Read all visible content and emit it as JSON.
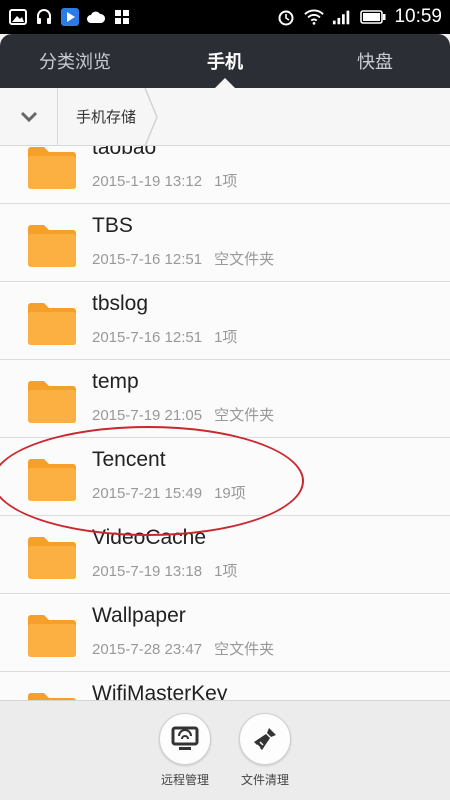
{
  "status_bar": {
    "time": "10:59"
  },
  "tabs": [
    {
      "label": "分类浏览",
      "active": false
    },
    {
      "label": "手机",
      "active": true
    },
    {
      "label": "快盘",
      "active": false
    }
  ],
  "breadcrumb": {
    "current": "手机存储"
  },
  "files": [
    {
      "name": "taobao",
      "date": "2015-1-19 13:12",
      "info": "1项"
    },
    {
      "name": "TBS",
      "date": "2015-7-16 12:51",
      "info": "空文件夹"
    },
    {
      "name": "tbslog",
      "date": "2015-7-16 12:51",
      "info": "1项"
    },
    {
      "name": "temp",
      "date": "2015-7-19 21:05",
      "info": "空文件夹"
    },
    {
      "name": "Tencent",
      "date": "2015-7-21 15:49",
      "info": "19项"
    },
    {
      "name": "VideoCache",
      "date": "2015-7-19 13:18",
      "info": "1项"
    },
    {
      "name": "Wallpaper",
      "date": "2015-7-28 23:47",
      "info": "空文件夹"
    },
    {
      "name": "WifiMasterKey",
      "date": "",
      "info": ""
    }
  ],
  "bottom_bar": {
    "remote_label": "远程管理",
    "clean_label": "文件清理"
  },
  "colors": {
    "folder": "#fcb042",
    "folder_tab": "#f4a02a",
    "highlight_circle": "#c8282e",
    "tab_bg": "#2b2f35"
  }
}
